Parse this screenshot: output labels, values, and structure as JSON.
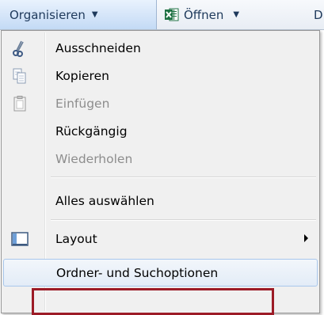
{
  "toolbar": {
    "organize_label": "Organisieren",
    "open_label": "Öffnen",
    "more_label": "D",
    "caret": "▼"
  },
  "menu": {
    "items": [
      {
        "label": "Ausschneiden",
        "icon": "scissors-icon",
        "enabled": true
      },
      {
        "label": "Kopieren",
        "icon": "copy-icon",
        "enabled": true
      },
      {
        "label": "Einfügen",
        "icon": "paste-icon",
        "enabled": false
      },
      {
        "label": "Rückgängig",
        "icon": null,
        "enabled": true
      },
      {
        "label": "Wiederholen",
        "icon": null,
        "enabled": false
      },
      {
        "label": "Alles auswählen",
        "icon": null,
        "enabled": true
      },
      {
        "label": "Layout",
        "icon": "layout-icon",
        "enabled": true,
        "submenu": true
      },
      {
        "label": "Ordner- und Suchoptionen",
        "icon": null,
        "enabled": true,
        "highlighted": true
      }
    ]
  },
  "colors": {
    "highlight_border": "#9c1b26",
    "menu_bg": "#f0f0f0",
    "toolbar_text": "#1e395b",
    "excel_green": "#1f7244"
  }
}
